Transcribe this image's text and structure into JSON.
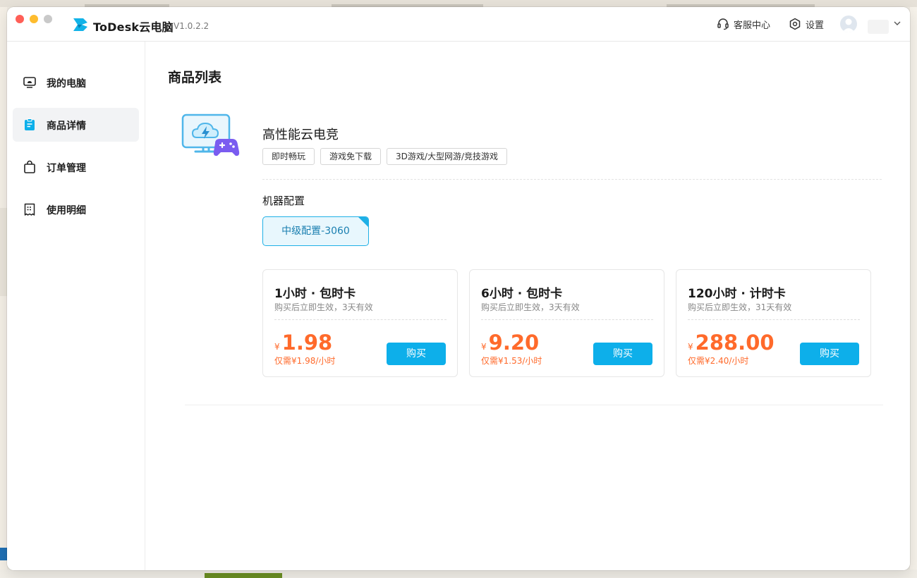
{
  "app": {
    "name": "ToDesk云电脑",
    "version": "V1.0.2.2",
    "accent_color": "#0DAFEA",
    "price_color": "#FF6A2B"
  },
  "header": {
    "service_label": "客服中心",
    "settings_label": "设置"
  },
  "sidebar": {
    "items": [
      {
        "label": "我的电脑",
        "icon": "monitor-icon",
        "active": false
      },
      {
        "label": "商品详情",
        "icon": "clipboard-icon",
        "active": true
      },
      {
        "label": "订单管理",
        "icon": "shopping-bag-icon",
        "active": false
      },
      {
        "label": "使用明细",
        "icon": "receipt-icon",
        "active": false
      }
    ]
  },
  "main": {
    "page_title": "商品列表",
    "product": {
      "name": "高性能云电竞",
      "tags": [
        "即时畅玩",
        "游戏免下载",
        "3D游戏/大型网游/竞技游戏"
      ]
    },
    "config_section_label": "机器配置",
    "selected_config": "中级配置-3060",
    "plans": [
      {
        "title": "1小时 · 包时卡",
        "subtitle": "购买后立即生效，3天有效",
        "currency": "¥",
        "price": "1.98",
        "unit_price": "仅需¥1.98/小时",
        "buy_label": "购买"
      },
      {
        "title": "6小时 · 包时卡",
        "subtitle": "购买后立即生效，3天有效",
        "currency": "¥",
        "price": "9.20",
        "unit_price": "仅需¥1.53/小时",
        "buy_label": "购买"
      },
      {
        "title": "120小时 · 计时卡",
        "subtitle": "购买后立即生效，31天有效",
        "currency": "¥",
        "price": "288.00",
        "unit_price": "仅需¥2.40/小时",
        "buy_label": "购买"
      }
    ]
  }
}
